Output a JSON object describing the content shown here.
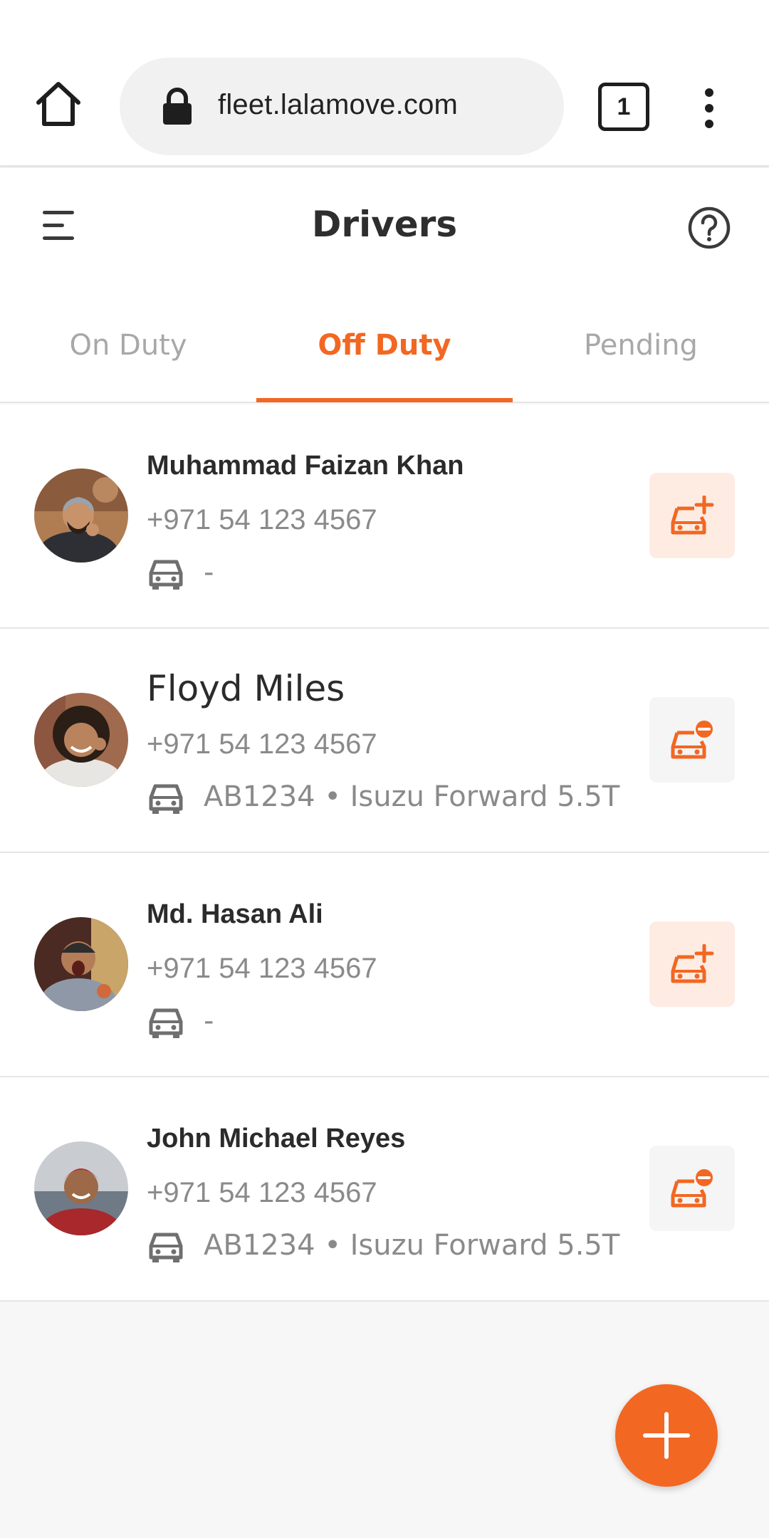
{
  "browser": {
    "url": "fleet.lalamove.com",
    "tab_count": "1",
    "icons": [
      "home-icon",
      "lock-icon",
      "tabs-icon",
      "more-vertical-icon"
    ]
  },
  "header": {
    "title": "Drivers",
    "menu_icon": "hamburger-menu-icon",
    "help_icon": "help-circle-icon"
  },
  "tabs": [
    {
      "label": "On Duty",
      "active": false
    },
    {
      "label": "Off Duty",
      "active": true
    },
    {
      "label": "Pending",
      "active": false
    }
  ],
  "drivers": [
    {
      "name": "Muhammad Faizan Khan",
      "phone": "+971 54 123 4567",
      "vehicle": "-",
      "action": "assign-vehicle"
    },
    {
      "name": "Floyd Miles",
      "phone": "+971 54 123 4567",
      "vehicle": "AB1234 • Isuzu Forward 5.5T",
      "action": "unassign-vehicle"
    },
    {
      "name": "Md. Hasan Ali",
      "phone": "+971 54 123 4567",
      "vehicle": "-",
      "action": "assign-vehicle"
    },
    {
      "name": "John Michael Reyes",
      "phone": "+971 54 123 4567",
      "vehicle": "AB1234 • Isuzu Forward 5.5T",
      "action": "unassign-vehicle"
    }
  ],
  "fab": {
    "icon": "plus-icon"
  },
  "colors": {
    "accent": "#f26722",
    "accent_soft": "#feece3",
    "text_primary": "#2b2b2b",
    "text_secondary": "#8a8a8a",
    "background": "#f7f7f7"
  }
}
